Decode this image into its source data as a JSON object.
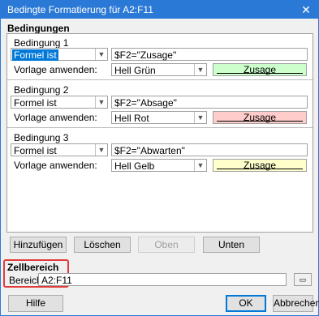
{
  "window": {
    "title": "Bedingte Formatierung für A2:F11",
    "close": "✕"
  },
  "conditions_section": {
    "title": "Bedingungen"
  },
  "conditions": [
    {
      "title": "Bedingung 1",
      "type": "Formel ist",
      "formula": "$F2=\"Zusage\"",
      "style_label": "Vorlage anwenden:",
      "style": "Hell Grün",
      "preview": "Zusage",
      "preview_color": "#ccffcc"
    },
    {
      "title": "Bedingung 2",
      "type": "Formel ist",
      "formula": "$F2=\"Absage\"",
      "style_label": "Vorlage anwenden:",
      "style": "Hell Rot",
      "preview": "Zusage",
      "preview_color": "#ffcccc"
    },
    {
      "title": "Bedingung 3",
      "type": "Formel ist",
      "formula": "$F2=\"Abwarten\"",
      "style_label": "Vorlage anwenden:",
      "style": "Hell Gelb",
      "preview": "Zusage",
      "preview_color": "#ffffcc"
    }
  ],
  "buttons": {
    "add": "Hinzufügen",
    "delete": "Löschen",
    "up": "Oben",
    "down": "Unten"
  },
  "range": {
    "title": "Zellbereich",
    "label": "Bereich:",
    "value": "A2:F11"
  },
  "footer": {
    "help": "Hilfe",
    "ok": "OK",
    "cancel": "Abbrechen"
  }
}
